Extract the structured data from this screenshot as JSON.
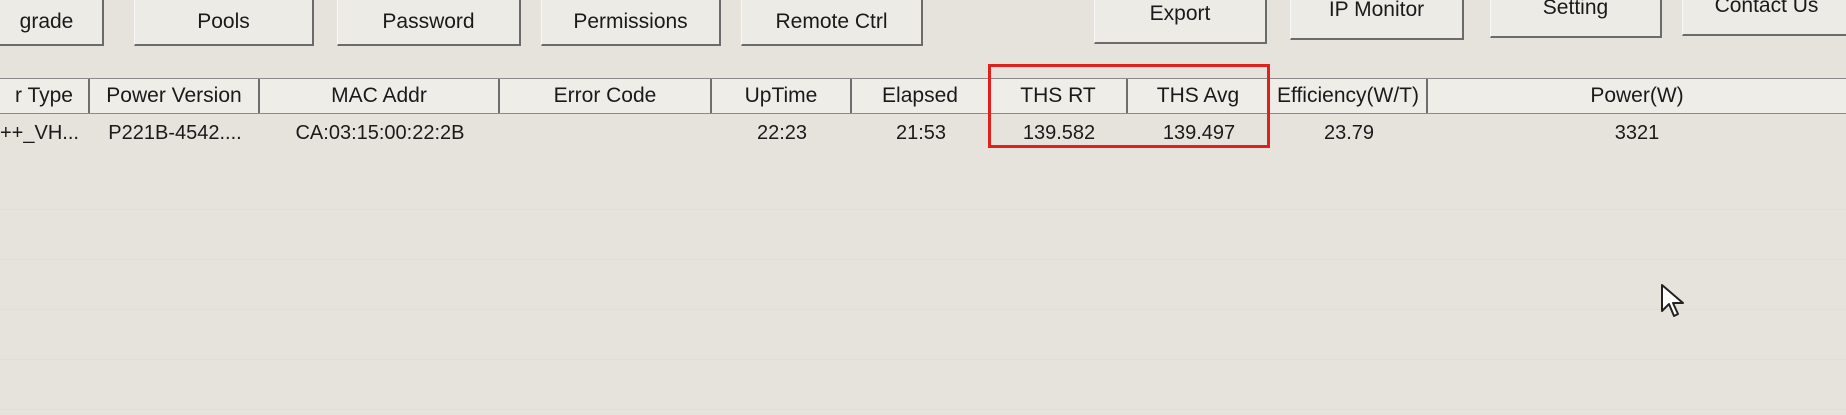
{
  "toolbar": {
    "upgrade": "grade",
    "pools": "Pools",
    "password": "Password",
    "permissions": "Permissions",
    "remote_ctrl": "Remote Ctrl",
    "export": "Export",
    "ip_monitor": "IP Monitor",
    "setting": "Setting",
    "contact_us": "Contact Us"
  },
  "table": {
    "headers": [
      "r Type",
      "Power Version",
      "MAC Addr",
      "Error Code",
      "UpTime",
      "Elapsed",
      "THS RT",
      "THS Avg",
      "Efficiency(W/T)",
      "Power(W)"
    ],
    "row": [
      "++_VH...",
      "P221B-4542....",
      "CA:03:15:00:22:2B",
      "",
      "22:23",
      "21:53",
      "139.582",
      "139.497",
      "23.79",
      "3321"
    ]
  },
  "colors": {
    "highlight": "#e0201c"
  },
  "icons": {
    "cursor": "mouse-pointer-icon"
  }
}
